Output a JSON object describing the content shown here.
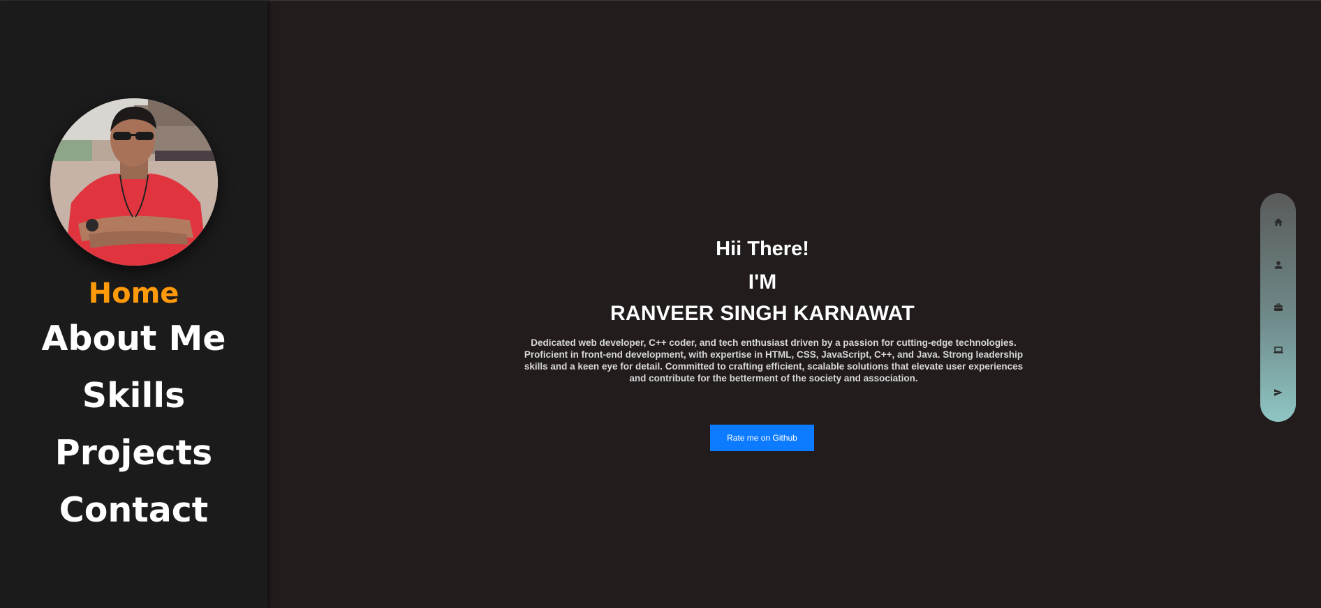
{
  "sidebar": {
    "nav": [
      {
        "label": "Home",
        "active": true
      },
      {
        "label": "About Me",
        "active": false
      },
      {
        "label": "Skills",
        "active": false
      },
      {
        "label": "Projects",
        "active": false
      },
      {
        "label": "Contact",
        "active": false
      }
    ]
  },
  "hero": {
    "greeting": "Hii There!",
    "im": "I'M",
    "name": "RANVEER SINGH KARNAWAT",
    "bio": "Dedicated web developer, C++ coder, and tech enthusiast driven by a passion for cutting-edge technologies. Proficient in front-end development, with expertise in HTML, CSS, JavaScript, C++, and Java. Strong leadership skills and a keen eye for detail. Committed to crafting efficient, scalable solutions that elevate user experiences and contribute for the betterment of the society and association.",
    "cta_label": "Rate me on Github"
  },
  "dock": {
    "icons": [
      "home-icon",
      "person-icon",
      "briefcase-icon",
      "laptop-icon",
      "send-icon"
    ]
  },
  "colors": {
    "background": "#221c1c",
    "sidebar": "#1b1b1b",
    "accent": "#ff9a0a",
    "button": "#0d7bff"
  }
}
